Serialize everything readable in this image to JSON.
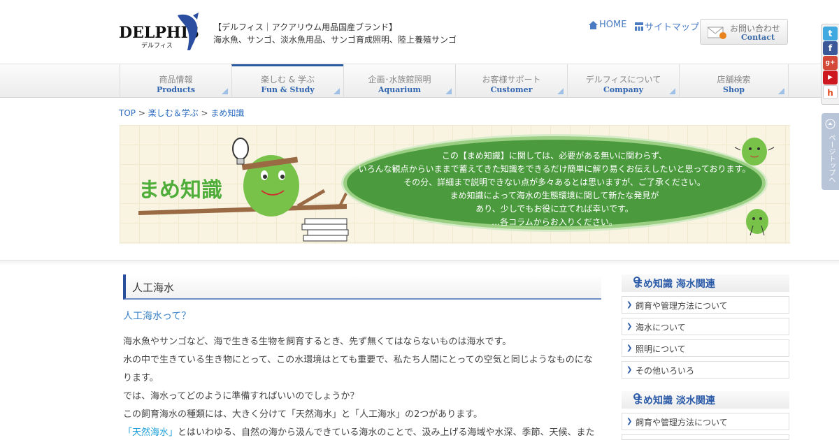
{
  "header": {
    "logo_text": "DELPHIS",
    "logo_sub": "デルフィス",
    "tagline1": "【デルフィス｜アクアリウム用品国産ブランド】",
    "tagline2": "海水魚、サンゴ、淡水魚用品、サンゴ育成照明、陸上養殖サンゴ",
    "home_label": "HOME",
    "sitemap_label": "サイトマップ",
    "contact_jp": "お問い合わせ",
    "contact_en": "Contact"
  },
  "nav": [
    {
      "jp": "商品情報",
      "en": "Products"
    },
    {
      "jp": "楽しむ & 学ぶ",
      "en": "Fun & Study"
    },
    {
      "jp": "企画･水族館照明",
      "en": "Aquarium"
    },
    {
      "jp": "お客様サポート",
      "en": "Customer"
    },
    {
      "jp": "デルフィスについて",
      "en": "Company"
    },
    {
      "jp": "店舗検索",
      "en": "Shop"
    }
  ],
  "breadcrumb": {
    "top": "TOP",
    "sep1": " > ",
    "fun": "楽しむ＆学ぶ",
    "sep2": " > ",
    "current": "まめ知識"
  },
  "banner": {
    "title": "まめ知識",
    "lines": [
      "この【まめ知識】に関しては、必要がある無いに関わらず、",
      "いろんな観点からいままで蓄えてきた知識をできるだけ簡単に解り易くお伝えしたいと思っております。",
      "その分、詳細まで説明できない点が多々あるとは思いますが、ご了承ください。",
      "まめ知識によって海水の生態環境に関して新たな発見が",
      "あり、少しでもお役に立てれば幸いです。",
      "…各コラムからお入りください。"
    ]
  },
  "article": {
    "heading": "人工海水",
    "subheading": "人工海水って？",
    "p1": "海水魚やサンゴなど、海で生きる生物を飼育するとき、先ず無くてはならないものは海水です。",
    "p2": "水の中で生きている生き物にとって、この水環境はとても重要で、私たち人間にとっての空気と同じようなものにな",
    "p3": "ります。",
    "p4": "では、海水ってどのように準備すればいいのでしょうか？",
    "p5": "この飼育海水の種類には、大きく分けて「天然海水」と「人工海水」の2つがあります。",
    "p6_hl": "「天然海水」",
    "p6": "とはいわゆる、自然の海から汲んできている海水のことで、汲み上げる海域や水深、季節、天候、また"
  },
  "sidebar": {
    "section1": {
      "title": "まめ知識 海水関連",
      "items": [
        "飼育や管理方法について",
        "海水について",
        "照明について",
        "その他いろいろ"
      ]
    },
    "section2": {
      "title": "まめ知識 淡水関連",
      "items": [
        "飼育や管理方法について"
      ]
    }
  },
  "social": [
    "t",
    "f",
    "g+",
    "▶",
    "h"
  ],
  "pagetop_label": "ページトップへ",
  "colors": {
    "accent": "#2a5aa8",
    "link": "#2b6bc0",
    "banner_green": "#4b9b3e"
  }
}
